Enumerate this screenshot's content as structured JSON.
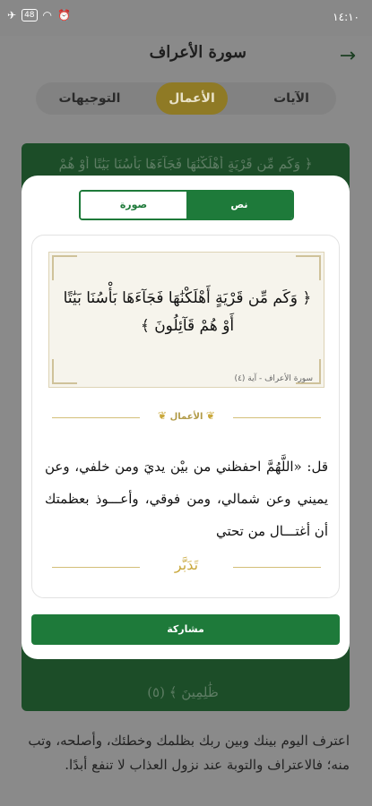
{
  "status_bar": {
    "left_icons": "✈",
    "battery": "48",
    "time": "١٤:١٠"
  },
  "header": {
    "title": "سورة الأعراف",
    "back_icon": "→"
  },
  "tabs": [
    {
      "label": "الآيات"
    },
    {
      "label": "الأعمال"
    },
    {
      "label": "التوجيهات"
    }
  ],
  "background": {
    "verse_top": "﴿ وَكَم مِّن قَرْيَةٍ أَهْلَكْنَٰهَا فَجَآءَهَا بَأْسُنَا بَيَٰتًا أَوْ هُمْ",
    "verse_bottom": "ظَٰلِمِينَ ﴾ (٥)",
    "below_text": "اعترف اليوم بينك وبين ربك بظلمك وخطئك، وأصلحه، وتب منه؛ فالاعتراف والتوبة عند نزول العذاب لا تنفع أبدًا."
  },
  "modal": {
    "toggle": {
      "text": "نص",
      "image": "صورة"
    },
    "verse": "﴿ وَكَم مِّن قَرْيَةٍ أَهْلَكْنَٰهَا فَجَآءَهَا بَأْسُنَا بَيَٰتًا أَوْ هُمْ قَآئِلُونَ ﴾",
    "reference": "سورة الأعراف - آية (٤)",
    "section_label": "الأعمال",
    "body": "قل: «اللَّهُمَّ احفظني من بيْن يديَ ومن خلفي، وعن يميني وعن شمالي، ومن فوقي، وأعـــوذ بعظمتك أن أغتـــال من تحتي",
    "signature": "تَدَبَّر",
    "share_label": "مشاركة"
  },
  "colors": {
    "primary_green": "#1e7a3a",
    "gold": "#8f7a25",
    "overlay_gray": "#8a8a8a"
  }
}
